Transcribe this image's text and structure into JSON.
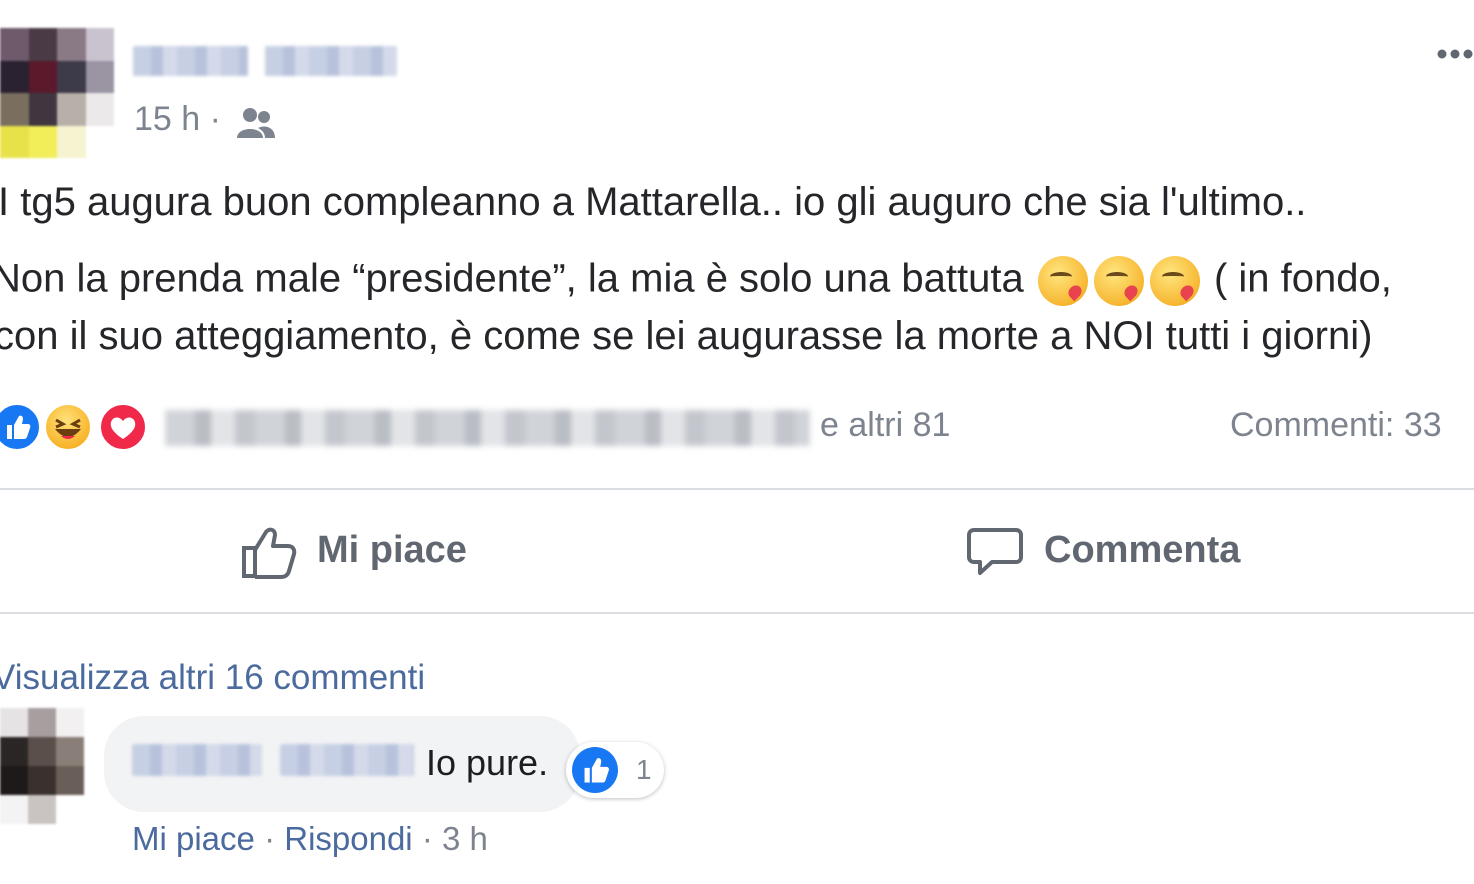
{
  "post": {
    "time": "15 h",
    "dot": "·",
    "audience_icon": "friends-icon",
    "more_icon": "more-options-icon",
    "line1": "I tg5 augura buon compleanno a Mattarella.. io gli auguro che sia l'ultimo..",
    "line2_before": "Non la prenda male “presidente”, la mia è solo una battuta",
    "line2_after": "( in fondo,",
    "line3": "con il suo atteggiamento, è come se lei augurasse la morte a NOI tutti i giorni)"
  },
  "reactions": {
    "others": "e altri 81",
    "comments_count": "Commenti: 33",
    "icons": [
      "like-reaction-icon",
      "haha-reaction-icon",
      "love-reaction-icon"
    ]
  },
  "actions": {
    "like": "Mi piace",
    "comment": "Commenta"
  },
  "comments": {
    "view_more": "Visualizza altri 16 commenti",
    "first": {
      "text": "Io pure.",
      "like_count": "1",
      "like": "Mi piace",
      "reply": "Rispondi",
      "time": "3 h",
      "sep": "·"
    }
  },
  "colors": {
    "like_blue": "#1877f2",
    "love_red": "#f0284a",
    "haha_yellow": "#f7b731",
    "link_blue": "#4b6a9d",
    "meta_gray": "#7d848f"
  }
}
